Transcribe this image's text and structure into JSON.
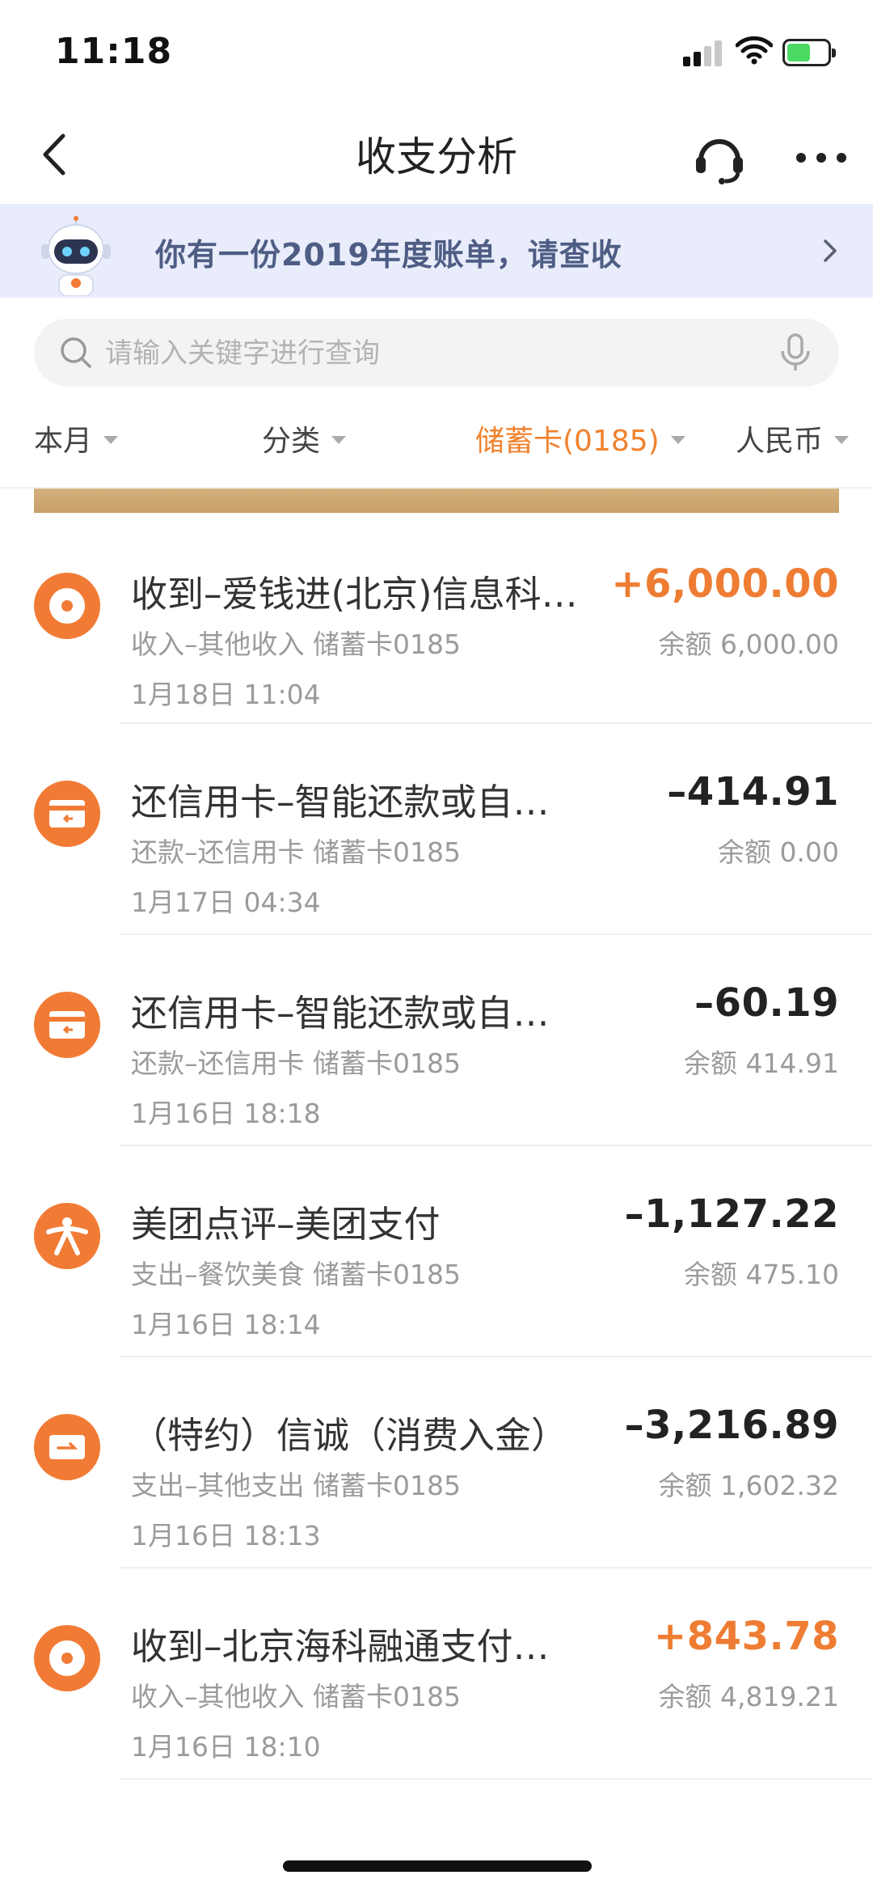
{
  "status_bar": {
    "time": "11:18"
  },
  "nav": {
    "title": "收支分析",
    "back_icon": "back-chevron-icon",
    "service_icon": "headset-icon",
    "more_icon": "more-dots-icon"
  },
  "banner": {
    "text": "你有一份2019年度账单，请查收"
  },
  "search": {
    "placeholder": "请输入关键字进行查询"
  },
  "filters": [
    {
      "label": "本月",
      "active": false
    },
    {
      "label": "分类",
      "active": false
    },
    {
      "label": "储蓄卡(0185)",
      "active": true
    },
    {
      "label": "人民币",
      "active": false
    }
  ],
  "colors": {
    "accent": "#f17b35",
    "income": "#ee7d33",
    "banner_bg": "#e9ecfa",
    "banner_text": "#4e5d84"
  },
  "transactions": [
    {
      "icon": "coin-icon",
      "title": "收到–爱钱进(北京)信息科…",
      "amount": "+6,000.00",
      "type": "income",
      "category": "收入–其他收入 储蓄卡0185",
      "balance": "余额 6,000.00",
      "time": "1月18日 11:04"
    },
    {
      "icon": "credit-card-repay-icon",
      "title": "还信用卡–智能还款或自…",
      "amount": "–414.91",
      "type": "expense",
      "category": "还款–还信用卡 储蓄卡0185",
      "balance": "余额 0.00",
      "time": "1月17日 04:34"
    },
    {
      "icon": "credit-card-repay-icon",
      "title": "还信用卡–智能还款或自…",
      "amount": "–60.19",
      "type": "expense",
      "category": "还款–还信用卡 储蓄卡0185",
      "balance": "余额 414.91",
      "time": "1月16日 18:18"
    },
    {
      "icon": "meituan-logo-icon",
      "title": "美团点评–美团支付",
      "amount": "–1,127.22",
      "type": "expense",
      "category": "支出–餐饮美食 储蓄卡0185",
      "balance": "余额 475.10",
      "time": "1月16日 18:14"
    },
    {
      "icon": "transfer-icon",
      "title": "（特约）信诚（消费入金）",
      "amount": "–3,216.89",
      "type": "expense",
      "category": "支出–其他支出 储蓄卡0185",
      "balance": "余额 1,602.32",
      "time": "1月16日 18:13"
    },
    {
      "icon": "coin-icon",
      "title": "收到–北京海科融通支付…",
      "amount": "+843.78",
      "type": "income",
      "category": "收入–其他收入 储蓄卡0185",
      "balance": "余额 4,819.21",
      "time": "1月16日 18:10"
    }
  ]
}
